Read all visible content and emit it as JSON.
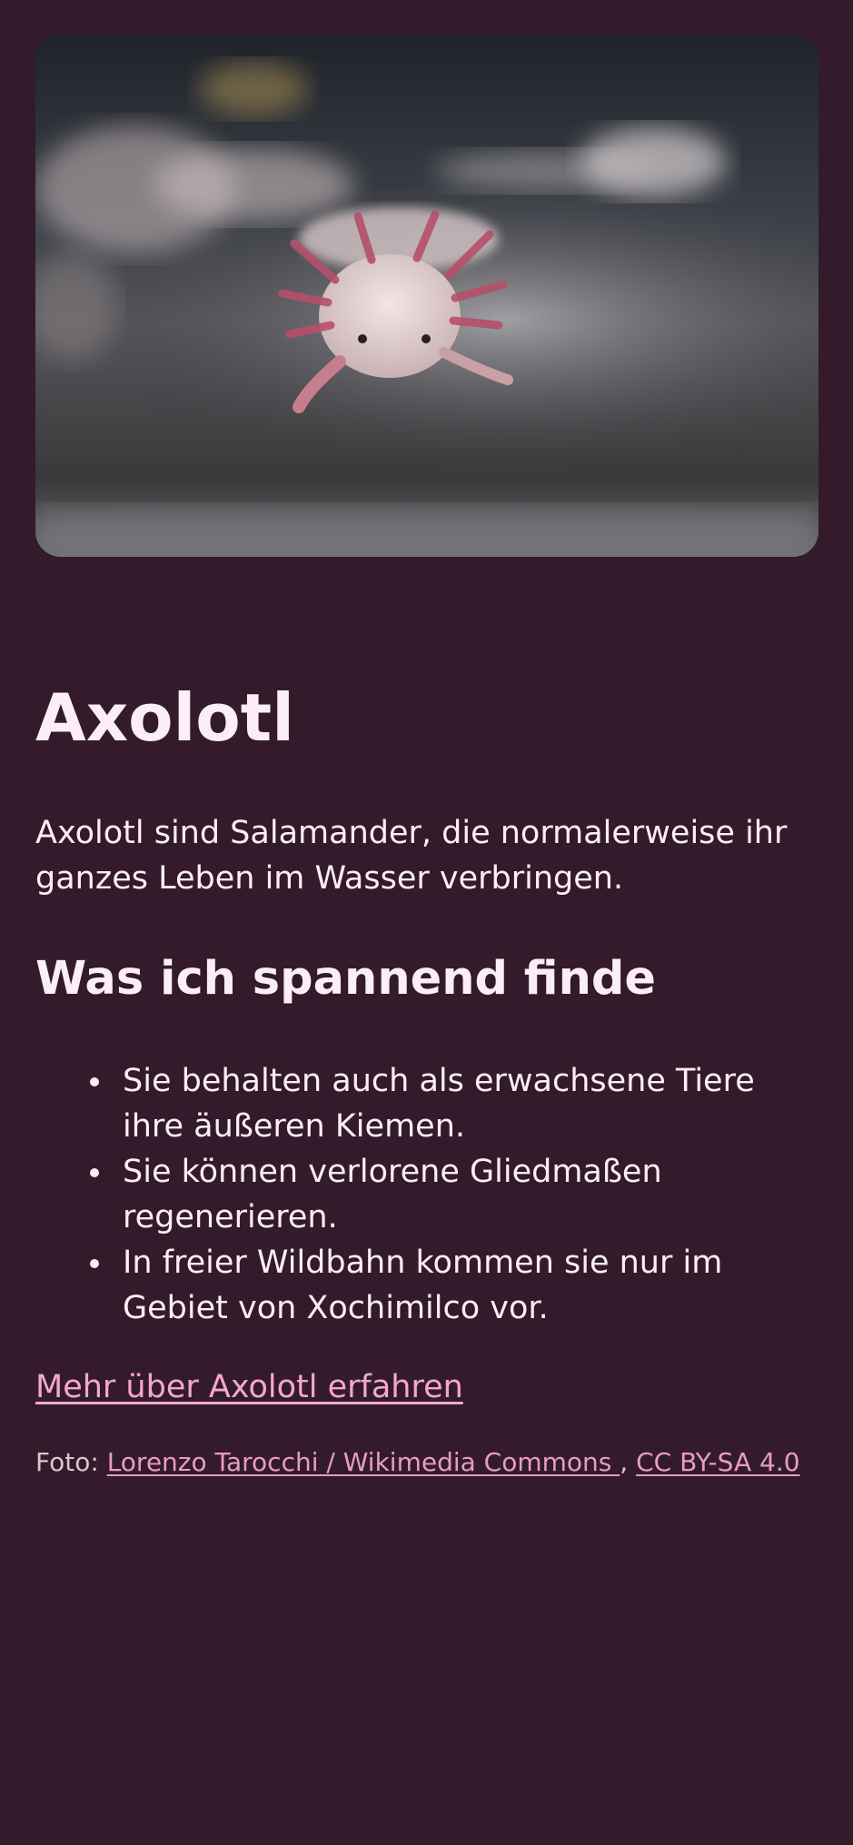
{
  "hero_image": {
    "subject": "axolotl-photo"
  },
  "title": "Axolotl",
  "intro": "Axolotl sind Salamander, die normalerweise ihr ganzes Leben im Wasser verbringen.",
  "subtitle": "Was ich spannend finde",
  "facts": [
    "Sie behalten auch als erwachsene Tiere ihre äußeren Kiemen.",
    "Sie können verlorene Gliedmaßen regenerieren.",
    "In freier Wildbahn kommen sie nur im Gebiet von Xochimilco vor."
  ],
  "more_link": "Mehr über Axolotl erfahren",
  "credit": {
    "prefix": "Foto:",
    "author_link": "Lorenzo Tarocchi / Wikimedia Commons ",
    "separator": ",",
    "license_link": "CC BY-SA 4.0"
  },
  "colors": {
    "background": "#331b2b",
    "text": "#fbeef6",
    "link": "#f5a6d0"
  }
}
